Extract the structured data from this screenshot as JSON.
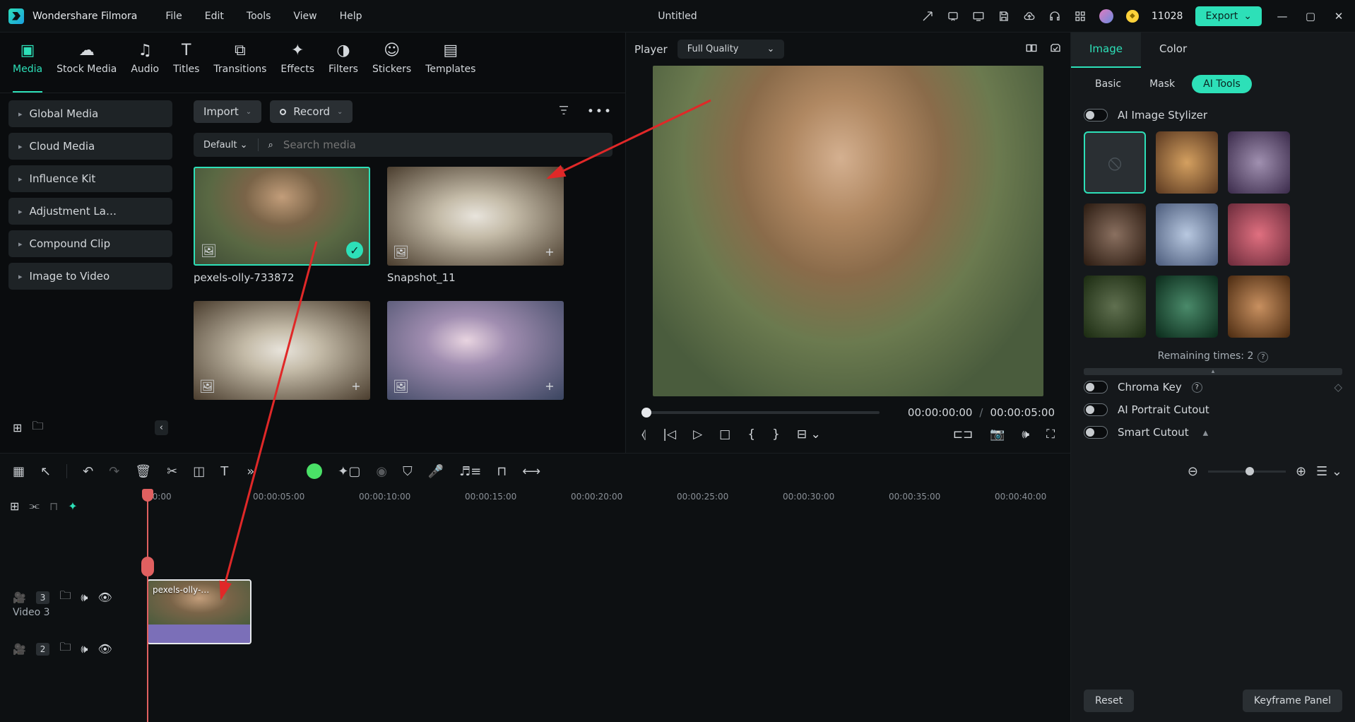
{
  "app": {
    "name": "Wondershare Filmora",
    "document": "Untitled",
    "points": "11028",
    "export": "Export"
  },
  "menu": [
    "File",
    "Edit",
    "Tools",
    "View",
    "Help"
  ],
  "nav_tabs": [
    {
      "label": "Media",
      "active": true
    },
    {
      "label": "Stock Media"
    },
    {
      "label": "Audio"
    },
    {
      "label": "Titles"
    },
    {
      "label": "Transitions"
    },
    {
      "label": "Effects"
    },
    {
      "label": "Filters"
    },
    {
      "label": "Stickers"
    },
    {
      "label": "Templates"
    }
  ],
  "sidebar": {
    "items": [
      "Global Media",
      "Cloud Media",
      "Influence Kit",
      "Adjustment La…",
      "Compound Clip",
      "Image to Video"
    ]
  },
  "browser": {
    "import": "Import",
    "record": "Record",
    "sort": "Default",
    "search_placeholder": "Search media",
    "thumbs": [
      {
        "label": "pexels-olly-733872",
        "selected": true,
        "kind": "portrait"
      },
      {
        "label": "Snapshot_11",
        "selected": false,
        "kind": "dog"
      },
      {
        "label": "",
        "selected": false,
        "kind": "dog"
      },
      {
        "label": "",
        "selected": false,
        "kind": "snap"
      }
    ]
  },
  "preview": {
    "label": "Player",
    "quality": "Full Quality",
    "time_current": "00:00:00:00",
    "time_total": "00:00:05:00"
  },
  "inspector": {
    "tabs": [
      {
        "label": "Image",
        "active": true
      },
      {
        "label": "Color"
      }
    ],
    "subtabs": [
      {
        "label": "Basic"
      },
      {
        "label": "Mask"
      },
      {
        "label": "AI Tools",
        "active": true
      }
    ],
    "ai_stylizer": "AI Image Stylizer",
    "remaining": "Remaining times: 2",
    "chroma": "Chroma Key",
    "portrait": "AI Portrait Cutout",
    "smart": "Smart Cutout",
    "reset": "Reset",
    "keyframe": "Keyframe Panel"
  },
  "timeline": {
    "ticks": [
      "00:00",
      "00:00:05:00",
      "00:00:10:00",
      "00:00:15:00",
      "00:00:20:00",
      "00:00:25:00",
      "00:00:30:00",
      "00:00:35:00",
      "00:00:40:00"
    ],
    "tracks": [
      {
        "name": "Video 3",
        "badge": "3"
      },
      {
        "name": "",
        "badge": "2"
      }
    ],
    "clip_label": "pexels-olly-…"
  }
}
